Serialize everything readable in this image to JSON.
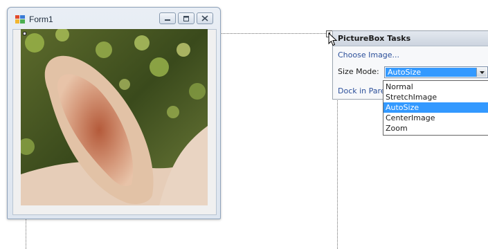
{
  "form": {
    "title": "Form1",
    "icon": "form-app-icon",
    "caption_buttons": [
      "minimize-icon",
      "maximize-icon",
      "close-icon"
    ]
  },
  "picturebox": {
    "content": "rabbit-ear-photo"
  },
  "tasks_panel": {
    "title": "PictureBox Tasks",
    "choose_image": "Choose Image...",
    "size_mode_label": "Size Mode:",
    "size_mode_value": "AutoSize",
    "dock_link": "Dock in Pare"
  },
  "dropdown": {
    "options": [
      "Normal",
      "StretchImage",
      "AutoSize",
      "CenterImage",
      "Zoom"
    ],
    "selected": "AutoSize"
  },
  "colors": {
    "selection": "#3399ff",
    "link": "#2b4f9a",
    "window_border": "#8fa3bb"
  }
}
